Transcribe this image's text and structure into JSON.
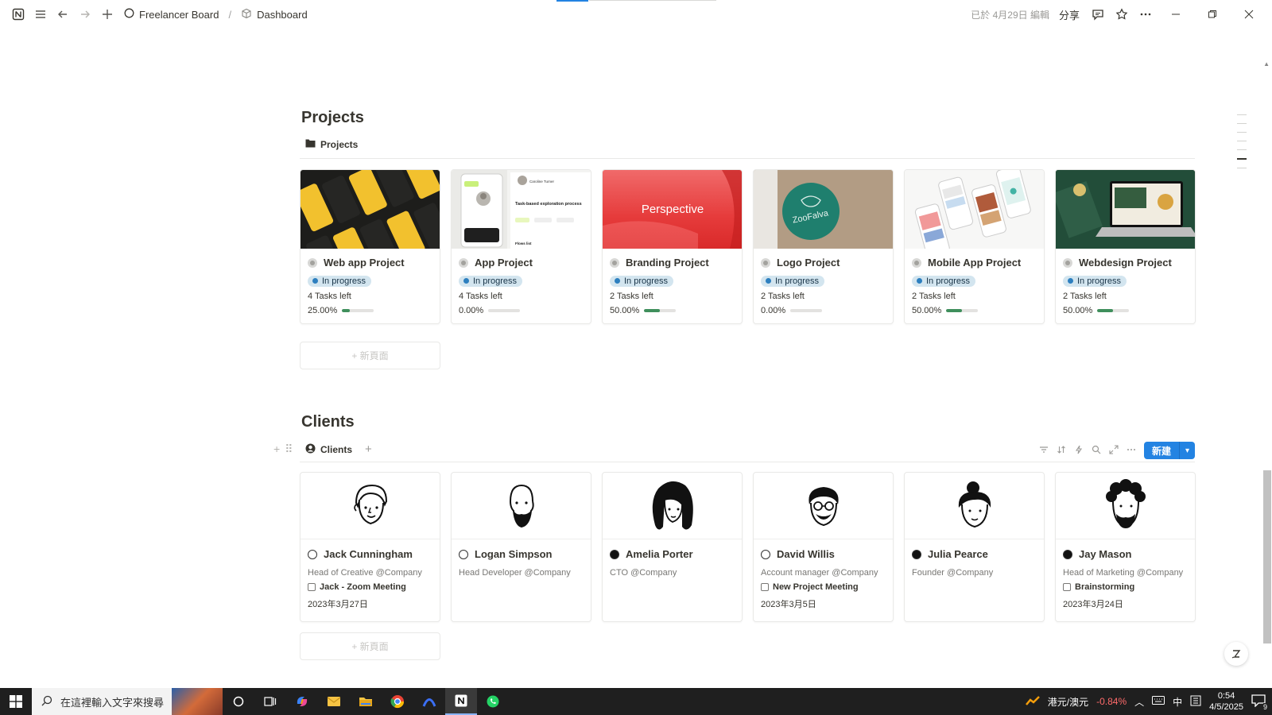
{
  "topbar": {
    "breadcrumb": [
      {
        "label": "Freelancer Board",
        "icon": "circle-icon"
      },
      {
        "label": "Dashboard",
        "icon": "cube-icon"
      }
    ],
    "edited": "已於 4月29日 編輯",
    "share": "分享"
  },
  "projects": {
    "title": "Projects",
    "view_label": "Projects",
    "new_page": "+ 新頁面",
    "cards": [
      {
        "title": "Web app Project",
        "status": "In progress",
        "tasks": "4 Tasks left",
        "progress_text": "25.00%",
        "progress": 0.25,
        "cover": "web-app"
      },
      {
        "title": "App Project",
        "status": "In progress",
        "tasks": "4 Tasks left",
        "progress_text": "0.00%",
        "progress": 0.0,
        "cover": "app"
      },
      {
        "title": "Branding Project",
        "status": "In progress",
        "tasks": "2 Tasks left",
        "progress_text": "50.00%",
        "progress": 0.5,
        "cover": "branding",
        "cover_text": "Perspective"
      },
      {
        "title": "Logo Project",
        "status": "In progress",
        "tasks": "2 Tasks left",
        "progress_text": "0.00%",
        "progress": 0.0,
        "cover": "logo",
        "cover_text": "ZooFalva"
      },
      {
        "title": "Mobile App Project",
        "status": "In progress",
        "tasks": "2 Tasks left",
        "progress_text": "50.00%",
        "progress": 0.5,
        "cover": "mobile"
      },
      {
        "title": "Webdesign Project",
        "status": "In progress",
        "tasks": "2 Tasks left",
        "progress_text": "50.00%",
        "progress": 0.5,
        "cover": "webdesign"
      }
    ],
    "app_cover_texts": {
      "name": "Caroline Turner",
      "heading": "Task-based exploration process",
      "footer": "Flows list"
    }
  },
  "clients": {
    "title": "Clients",
    "view_label": "Clients",
    "new_button": "新建",
    "new_page": "+ 新頁面",
    "cards": [
      {
        "name": "Jack Cunningham",
        "role": "Head of Creative @Company",
        "meeting": "Jack - Zoom Meeting",
        "date": "2023年3月27日"
      },
      {
        "name": "Logan Simpson",
        "role": "Head Developer @Company",
        "meeting": "",
        "date": ""
      },
      {
        "name": "Amelia Porter",
        "role": "CTO @Company",
        "meeting": "",
        "date": ""
      },
      {
        "name": "David Willis",
        "role": "Account manager @Company",
        "meeting": "New Project Meeting",
        "date": "2023年3月5日"
      },
      {
        "name": "Julia Pearce",
        "role": "Founder @Company",
        "meeting": "",
        "date": ""
      },
      {
        "name": "Jay Mason",
        "role": "Head of Marketing @Company",
        "meeting": "Brainstorming",
        "date": "2023年3月24日"
      }
    ]
  },
  "taskbar": {
    "search_placeholder": "在這裡輸入文字來搜尋",
    "currency": "港元/澳元",
    "currency_change": "-0.84%",
    "ime": "中",
    "time": "0:54",
    "date": "4/5/2025",
    "notification_count": "9"
  },
  "colors": {
    "accent": "#2383e2",
    "status_badge": "#d3e5ef",
    "progress": "#3f8f5c"
  }
}
